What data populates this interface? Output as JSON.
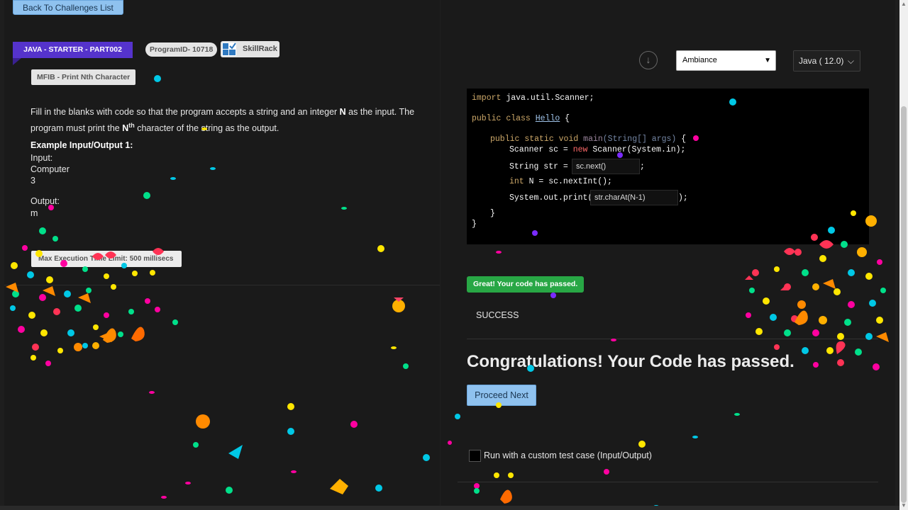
{
  "nav": {
    "back_label": "Back To Challenges List"
  },
  "challenge": {
    "ribbon": "JAVA - STARTER - PART002",
    "program_id": "ProgramID- 10718",
    "platform": "SkillRack",
    "title": "MFIB - Print Nth Character",
    "description_part1": "Fill in the blanks with code so that the program accepts a string and an integer ",
    "description_n": "N",
    "description_part2": " as the input. The program must print the ",
    "description_nth": "N",
    "description_sup": "th",
    "description_part3": " character of the string as the output.",
    "example_title": "Example Input/Output 1:",
    "input_label": "Input:",
    "input_line1": "Computer",
    "input_line2": "3",
    "output_label": "Output:",
    "output_line1": "m",
    "limit_text": "Max Execution Time Limit: 500 millisecs"
  },
  "editor": {
    "theme": "Ambiance",
    "language": "Java ( 12.0)",
    "blank1": "sc.next()",
    "blank2": "str.charAt(N-1)"
  },
  "result": {
    "badge": "Great! Your code has passed.",
    "status": "SUCCESS",
    "congrats": "Congratulations! Your Code has passed.",
    "proceed_label": "Proceed Next",
    "custom_label": "Run with a custom test case (Input/Output)"
  },
  "colors": {
    "ribbon": "#5533cc",
    "button": "#8fc2ef",
    "success": "#28a745",
    "editor_bg": "#000000"
  }
}
